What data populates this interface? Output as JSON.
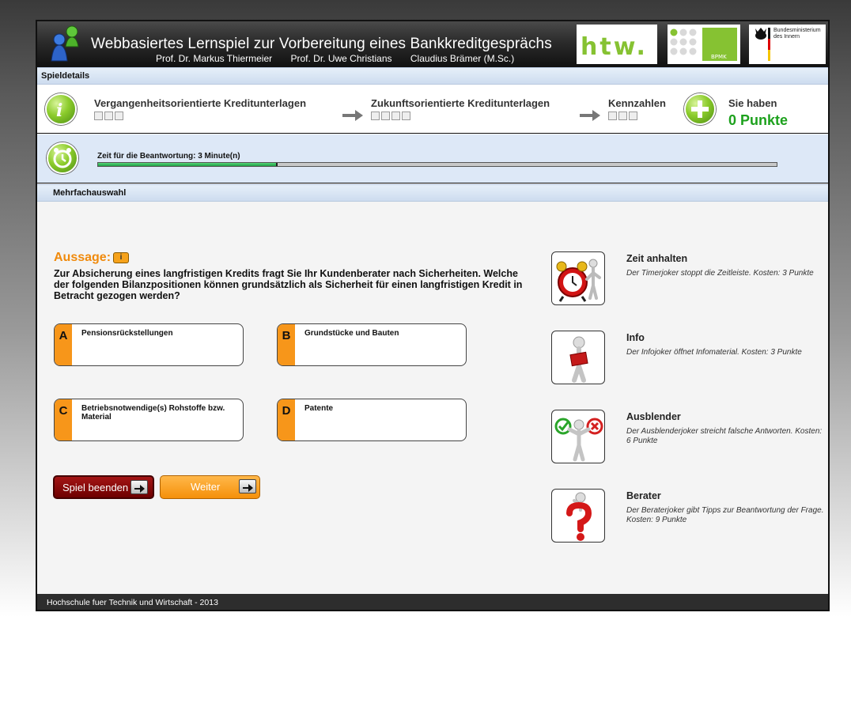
{
  "header": {
    "title": "Webbasiertes Lernspiel zur Vorbereitung eines Bankkreditgesprächs",
    "authors": [
      "Prof. Dr. Markus Thiermeier",
      "Prof. Dr. Uwe Christians",
      "Claudius Brämer (M.Sc.)"
    ],
    "logos": {
      "htw": "htw.",
      "bpmk": "BPMK",
      "bmi": "Bundesministerium des Innern"
    }
  },
  "spieldetails": {
    "section_label": "Spieldetails",
    "steps": [
      {
        "title": "Vergangenheitsorientierte Kreditunterlagen",
        "boxes": 3
      },
      {
        "title": "Zukunftsorientierte Kreditunterlagen",
        "boxes": 4
      },
      {
        "title": "Kennzahlen",
        "boxes": 3
      }
    ],
    "points_label": "Sie haben",
    "points_value": "0 Punkte"
  },
  "timer": {
    "label": "Zeit für die Beantwortung: 3 Minute(n)",
    "progress": 0.265
  },
  "mehrfachauswahl": {
    "section_label": "Mehrfachauswahl",
    "aussage_label": "Aussage:",
    "info_badge": "i",
    "question": "Zur Absicherung eines langfristigen Kredits fragt Sie Ihr Kundenberater nach Sicherheiten. Welche der folgenden Bilanzpositionen können grundsätzlich als Sicherheit für einen langfristigen Kredit in Betracht gezogen werden?",
    "answers": [
      {
        "letter": "A",
        "text": "Pensionsrückstellungen"
      },
      {
        "letter": "B",
        "text": "Grundstücke und Bauten"
      },
      {
        "letter": "C",
        "text": "Betriebsnotwendige(s) Rohstoffe bzw. Material"
      },
      {
        "letter": "D",
        "text": "Patente"
      }
    ],
    "buttons": {
      "end": "Spiel beenden",
      "next": "Weiter"
    }
  },
  "jokers": [
    {
      "icon": "alarm-clock-icon",
      "title": "Zeit anhalten",
      "description": "Der Timerjoker stoppt die Zeitleiste. Kosten: 3 Punkte"
    },
    {
      "icon": "reading-figure-icon",
      "title": "Info",
      "description": "Der Infojoker öffnet Infomaterial. Kosten: 3 Punkte"
    },
    {
      "icon": "check-cross-figure-icon",
      "title": "Ausblender",
      "description": "Der Ausblenderjoker streicht falsche Antworten. Kosten: 6 Punkte"
    },
    {
      "icon": "question-figure-icon",
      "title": "Berater",
      "description": "Der Beraterjoker gibt Tipps zur Beantwortung der Frage. Kosten: 9 Punkte"
    }
  ],
  "footer": {
    "text": "Hochschule fuer Technik und Wirtschaft - 2013"
  },
  "colors": {
    "accent_orange": "#f7961a",
    "points_green": "#1da11d",
    "end_button_red": "#8a0a0a",
    "section_bar_blue": "#dde8f7"
  }
}
